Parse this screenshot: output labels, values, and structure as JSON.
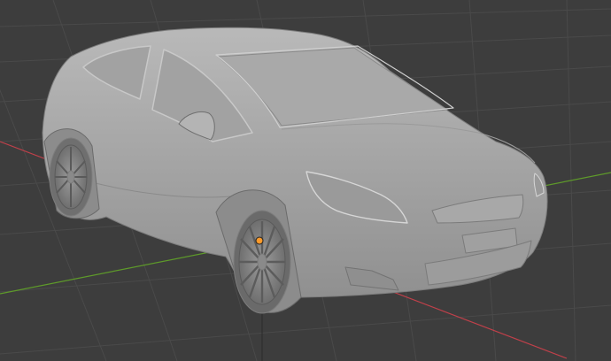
{
  "viewport": {
    "background_color": "#3d3d3d",
    "grid_line_color": "#4a4a4a",
    "x_axis_color": "#c0404a",
    "y_axis_color": "#5e9a2a",
    "z_axis_color": "#2f2f2f"
  },
  "scene": {
    "object": "car-model",
    "shading": "solid",
    "body_color": "#a4a4a4",
    "selected": true,
    "origin_color": "#ff9a2a"
  }
}
